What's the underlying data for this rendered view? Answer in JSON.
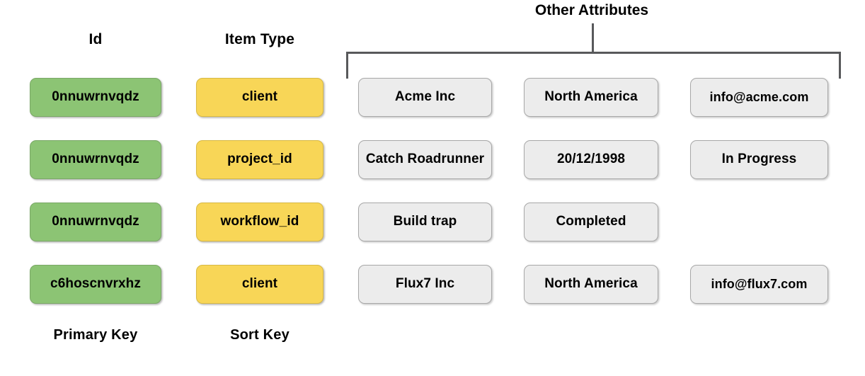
{
  "diagram": {
    "title_group": "Other Attributes",
    "headers": {
      "id": "Id",
      "item_type": "Item Type"
    },
    "footers": {
      "primary_key": "Primary Key",
      "sort_key": "Sort Key"
    },
    "colors": {
      "primary_key_fill": "#8cc474",
      "sort_key_fill": "#f8d657",
      "attribute_fill": "#ececec",
      "bracket_stroke": "#58595b",
      "text": "#000000",
      "background": "#ffffff"
    },
    "rows": [
      {
        "id": "0nnuwrnvqdz",
        "item_type": "client",
        "attributes": [
          "Acme Inc",
          "North America",
          "info@acme.com"
        ]
      },
      {
        "id": "0nnuwrnvqdz",
        "item_type": "project_id",
        "attributes": [
          "Catch Roadrunner",
          "20/12/1998",
          "In Progress"
        ]
      },
      {
        "id": "0nnuwrnvqdz",
        "item_type": "workflow_id",
        "attributes": [
          "Build trap",
          "Completed"
        ]
      },
      {
        "id": "c6hoscnvrxhz",
        "item_type": "client",
        "attributes": [
          "Flux7 Inc",
          "North America",
          "info@flux7.com"
        ]
      }
    ]
  }
}
